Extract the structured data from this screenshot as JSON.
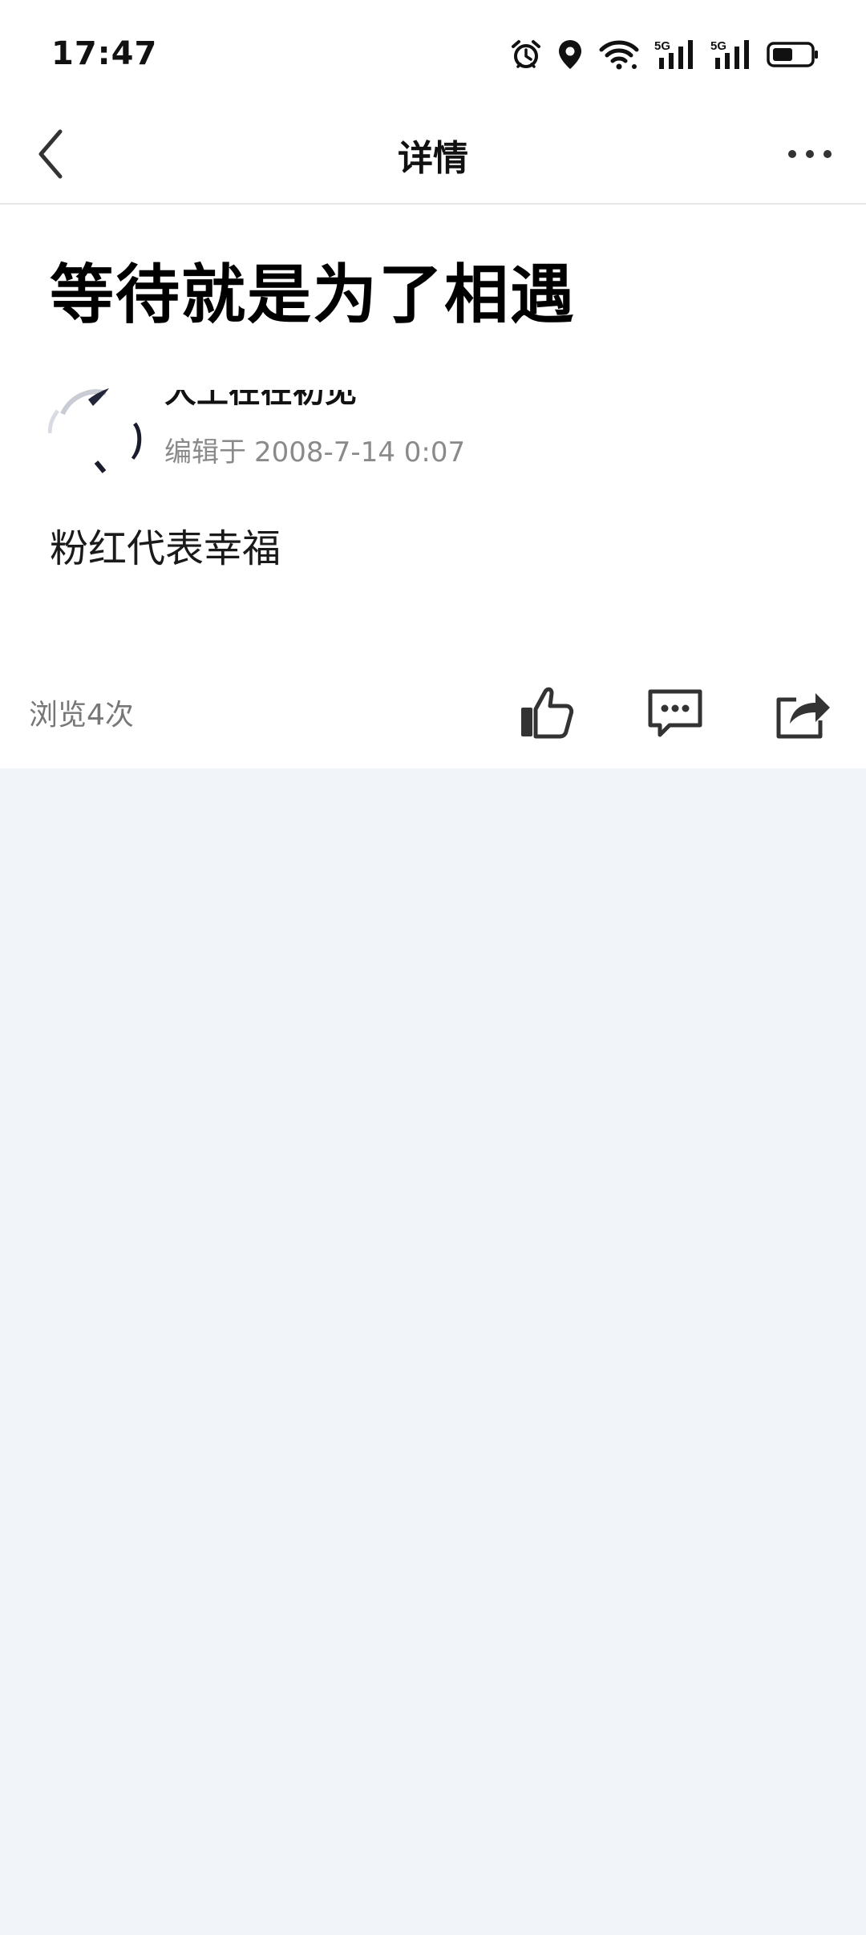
{
  "status_bar": {
    "time": "17:47",
    "icons": [
      "alarm-icon",
      "location-icon",
      "wifi-icon",
      "signal-5g-icon",
      "signal-5g-icon",
      "battery-icon"
    ],
    "network_1": "5G",
    "network_2": "5G"
  },
  "nav": {
    "title": "详情",
    "back_icon": "chevron-left-icon",
    "more_icon": "more-icon"
  },
  "article": {
    "title": "等待就是为了相遇",
    "author_name": "大土在在初见",
    "edit_prefix": "编辑于",
    "edit_time": "2008-7-14 0:07",
    "body": "粉红代表幸福"
  },
  "footer": {
    "views": "浏览4次",
    "actions": [
      "thumbs-up-icon",
      "comment-icon",
      "share-icon"
    ]
  },
  "colors": {
    "page_background": "#f1f4f9",
    "card_background": "#ffffff",
    "secondary_text": "#8a8a8a"
  }
}
